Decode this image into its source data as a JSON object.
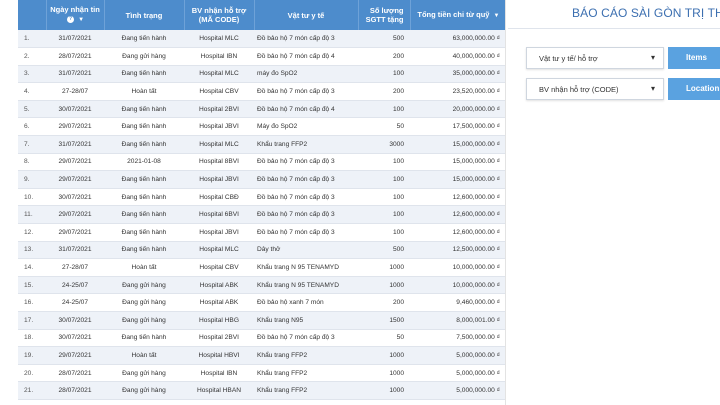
{
  "table": {
    "headers": {
      "idx": "",
      "date": "Ngày nhận tin",
      "status": "Tình trạng",
      "hospital": "BV nhận hỗ trợ (MÃ CODE)",
      "item": "Vật tư y tế",
      "qty": "Số lượng SGTT tặng",
      "total": "Tổng tiền chi từ quỹ"
    },
    "rows": [
      {
        "idx": "1.",
        "date": "31/07/2021",
        "status": "Đang tiến hành",
        "hospital": "Hospital MLC",
        "item": "Đồ bảo hộ 7 món cấp độ 3",
        "qty": "500",
        "total": "63,000,000.00 ₫"
      },
      {
        "idx": "2.",
        "date": "28/07/2021",
        "status": "Đang gửi hàng",
        "hospital": "Hospital IBN",
        "item": "Đồ bảo hộ 7 món cấp độ 4",
        "qty": "200",
        "total": "40,000,000.00 ₫"
      },
      {
        "idx": "3.",
        "date": "31/07/2021",
        "status": "Đang tiến hành",
        "hospital": "Hospital MLC",
        "item": "máy đo SpO2",
        "qty": "100",
        "total": "35,000,000.00 ₫"
      },
      {
        "idx": "4.",
        "date": "27-28/07",
        "status": "Hoàn tất",
        "hospital": "Hospital CBV",
        "item": "Đồ bảo hộ 7 món cấp độ 3",
        "qty": "200",
        "total": "23,520,000.00 ₫"
      },
      {
        "idx": "5.",
        "date": "30/07/2021",
        "status": "Đang tiến hành",
        "hospital": "Hospital 2BVI",
        "item": "Đồ bảo hộ 7 món cấp độ 4",
        "qty": "100",
        "total": "20,000,000.00 ₫"
      },
      {
        "idx": "6.",
        "date": "29/07/2021",
        "status": "Đang tiến hành",
        "hospital": "Hospital JBVI",
        "item": "Máy đo SpO2",
        "qty": "50",
        "total": "17,500,000.00 ₫"
      },
      {
        "idx": "7.",
        "date": "31/07/2021",
        "status": "Đang tiến hành",
        "hospital": "Hospital MLC",
        "item": "Khẩu trang FFP2",
        "qty": "3000",
        "total": "15,000,000.00 ₫"
      },
      {
        "idx": "8.",
        "date": "29/07/2021",
        "status": "2021-01-08",
        "hospital": "Hospital 8BVI",
        "item": "Đồ bảo hộ 7 món cấp độ 3",
        "qty": "100",
        "total": "15,000,000.00 ₫"
      },
      {
        "idx": "9.",
        "date": "29/07/2021",
        "status": "Đang tiến hành",
        "hospital": "Hospital JBVI",
        "item": "Đồ bảo hộ 7 món cấp độ 3",
        "qty": "100",
        "total": "15,000,000.00 ₫"
      },
      {
        "idx": "10.",
        "date": "30/07/2021",
        "status": "Đang tiến hành",
        "hospital": "Hospital CBĐ",
        "item": "Đồ bảo hộ 7 món cấp độ 3",
        "qty": "100",
        "total": "12,600,000.00 ₫"
      },
      {
        "idx": "11.",
        "date": "29/07/2021",
        "status": "Đang tiến hành",
        "hospital": "Hospital 6BVI",
        "item": "Đồ bảo hộ 7 món cấp độ 3",
        "qty": "100",
        "total": "12,600,000.00 ₫"
      },
      {
        "idx": "12.",
        "date": "29/07/2021",
        "status": "Đang tiến hành",
        "hospital": "Hospital JBVI",
        "item": "Đồ bảo hộ 7 món cấp độ 3",
        "qty": "100",
        "total": "12,600,000.00 ₫"
      },
      {
        "idx": "13.",
        "date": "31/07/2021",
        "status": "Đang tiến hành",
        "hospital": "Hospital MLC",
        "item": "Dây thở",
        "qty": "500",
        "total": "12,500,000.00 ₫"
      },
      {
        "idx": "14.",
        "date": "27-28/07",
        "status": "Hoàn tất",
        "hospital": "Hospital CBV",
        "item": "Khẩu trang N 95 TENAMYD",
        "qty": "1000",
        "total": "10,000,000.00 ₫"
      },
      {
        "idx": "15.",
        "date": "24-25/07",
        "status": "Đang gửi hàng",
        "hospital": "Hospital ABK",
        "item": "Khẩu trang N 95 TENAMYD",
        "qty": "1000",
        "total": "10,000,000.00 ₫"
      },
      {
        "idx": "16.",
        "date": "24-25/07",
        "status": "Đang gửi hàng",
        "hospital": "Hospital ABK",
        "item": "Đồ bảo hộ xanh 7 món",
        "qty": "200",
        "total": "9,460,000.00 ₫"
      },
      {
        "idx": "17.",
        "date": "30/07/2021",
        "status": "Đang gửi hàng",
        "hospital": "Hospital HBG",
        "item": "Khẩu trang N95",
        "qty": "1500",
        "total": "8,000,001.00 ₫"
      },
      {
        "idx": "18.",
        "date": "30/07/2021",
        "status": "Đang tiến hành",
        "hospital": "Hospital 2BVI",
        "item": "Đồ bảo hộ 7 món cấp độ 3",
        "qty": "50",
        "total": "7,500,000.00 ₫"
      },
      {
        "idx": "19.",
        "date": "29/07/2021",
        "status": "Hoàn tất",
        "hospital": "Hospital HBVI",
        "item": "Khẩu trang FFP2",
        "qty": "1000",
        "total": "5,000,000.00 ₫"
      },
      {
        "idx": "20.",
        "date": "28/07/2021",
        "status": "Đang gửi hàng",
        "hospital": "Hospital IBN",
        "item": "Khẩu trang FFP2",
        "qty": "1000",
        "total": "5,000,000.00 ₫"
      },
      {
        "idx": "21.",
        "date": "28/07/2021",
        "status": "Đang gửi hàng",
        "hospital": "Hospital HBAN",
        "item": "Khẩu trang FFP2",
        "qty": "1000",
        "total": "5,000,000.00 ₫"
      }
    ]
  },
  "side": {
    "report_title": "BÁO CÁO SÀI GÒN TRỊ THỨC",
    "filters": [
      {
        "label": "Vật tư y tế/ hỗ trợ",
        "button": "Items"
      },
      {
        "label": "BV nhận hỗ trợ (CODE)",
        "button": "Location"
      }
    ]
  },
  "colors": {
    "header_bg": "#4d8ccc",
    "button_bg": "#5aa2e0",
    "title_color": "#3c6fb0"
  },
  "icons": {
    "sort": "sort-desc-icon",
    "info": "info-icon",
    "caret": "dropdown-caret-icon"
  }
}
